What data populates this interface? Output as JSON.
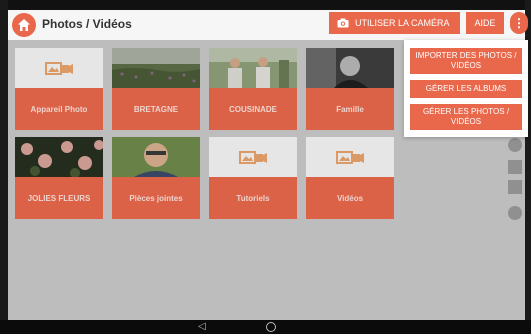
{
  "header": {
    "title": "Photos / Vidéos",
    "camera_label": "UTILISER LA CAMÉRA",
    "help_label": "AIDE",
    "menu_glyph": "⋮"
  },
  "colors": {
    "accent": "#e9684c",
    "topbar": "#f6f6f6",
    "content_bg": "#c9c9c9"
  },
  "albums": [
    {
      "label": "Appareil Photo",
      "icon": "photo-video-placeholder-icon"
    },
    {
      "label": "BRETAGNE",
      "icon": "thumbnail-meadow"
    },
    {
      "label": "COUSINADE",
      "icon": "thumbnail-people"
    },
    {
      "label": "Famille",
      "icon": "thumbnail-portrait"
    },
    {
      "label": "JOLIES FLEURS",
      "icon": "thumbnail-flowers"
    },
    {
      "label": "Pièces jointes",
      "icon": "thumbnail-man"
    },
    {
      "label": "Tutoriels",
      "icon": "photo-video-placeholder-icon"
    },
    {
      "label": "Vidéos",
      "icon": "photo-video-placeholder-icon"
    }
  ],
  "popup_menu": {
    "items": [
      {
        "label": "IMPORTER DES PHOTOS / VIDÉOS"
      },
      {
        "label": "GÉRER LES ALBUMS"
      },
      {
        "label": "GÉRER LES PHOTOS / VIDÉOS"
      }
    ]
  },
  "navbar": {
    "back_glyph": "◁"
  }
}
